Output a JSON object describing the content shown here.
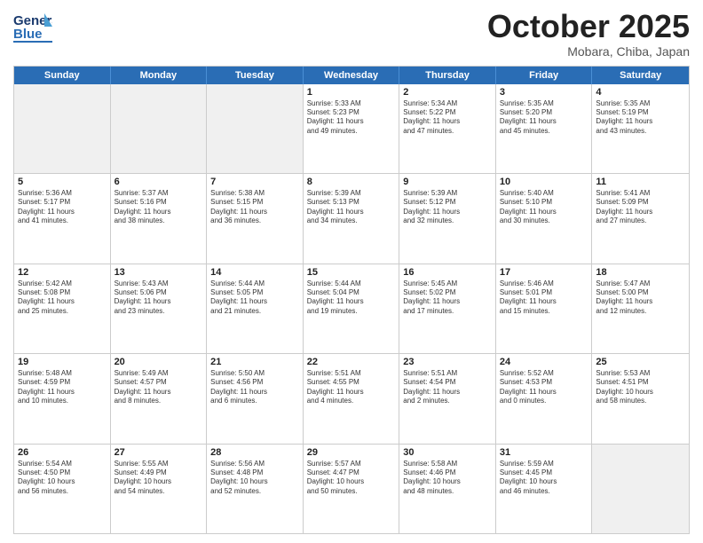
{
  "logo": {
    "line1": "General",
    "line2": "Blue"
  },
  "title": "October 2025",
  "subtitle": "Mobara, Chiba, Japan",
  "days": [
    "Sunday",
    "Monday",
    "Tuesday",
    "Wednesday",
    "Thursday",
    "Friday",
    "Saturday"
  ],
  "rows": [
    [
      {
        "day": "",
        "text": ""
      },
      {
        "day": "",
        "text": ""
      },
      {
        "day": "",
        "text": ""
      },
      {
        "day": "1",
        "text": "Sunrise: 5:33 AM\nSunset: 5:23 PM\nDaylight: 11 hours\nand 49 minutes."
      },
      {
        "day": "2",
        "text": "Sunrise: 5:34 AM\nSunset: 5:22 PM\nDaylight: 11 hours\nand 47 minutes."
      },
      {
        "day": "3",
        "text": "Sunrise: 5:35 AM\nSunset: 5:20 PM\nDaylight: 11 hours\nand 45 minutes."
      },
      {
        "day": "4",
        "text": "Sunrise: 5:35 AM\nSunset: 5:19 PM\nDaylight: 11 hours\nand 43 minutes."
      }
    ],
    [
      {
        "day": "5",
        "text": "Sunrise: 5:36 AM\nSunset: 5:17 PM\nDaylight: 11 hours\nand 41 minutes."
      },
      {
        "day": "6",
        "text": "Sunrise: 5:37 AM\nSunset: 5:16 PM\nDaylight: 11 hours\nand 38 minutes."
      },
      {
        "day": "7",
        "text": "Sunrise: 5:38 AM\nSunset: 5:15 PM\nDaylight: 11 hours\nand 36 minutes."
      },
      {
        "day": "8",
        "text": "Sunrise: 5:39 AM\nSunset: 5:13 PM\nDaylight: 11 hours\nand 34 minutes."
      },
      {
        "day": "9",
        "text": "Sunrise: 5:39 AM\nSunset: 5:12 PM\nDaylight: 11 hours\nand 32 minutes."
      },
      {
        "day": "10",
        "text": "Sunrise: 5:40 AM\nSunset: 5:10 PM\nDaylight: 11 hours\nand 30 minutes."
      },
      {
        "day": "11",
        "text": "Sunrise: 5:41 AM\nSunset: 5:09 PM\nDaylight: 11 hours\nand 27 minutes."
      }
    ],
    [
      {
        "day": "12",
        "text": "Sunrise: 5:42 AM\nSunset: 5:08 PM\nDaylight: 11 hours\nand 25 minutes."
      },
      {
        "day": "13",
        "text": "Sunrise: 5:43 AM\nSunset: 5:06 PM\nDaylight: 11 hours\nand 23 minutes."
      },
      {
        "day": "14",
        "text": "Sunrise: 5:44 AM\nSunset: 5:05 PM\nDaylight: 11 hours\nand 21 minutes."
      },
      {
        "day": "15",
        "text": "Sunrise: 5:44 AM\nSunset: 5:04 PM\nDaylight: 11 hours\nand 19 minutes."
      },
      {
        "day": "16",
        "text": "Sunrise: 5:45 AM\nSunset: 5:02 PM\nDaylight: 11 hours\nand 17 minutes."
      },
      {
        "day": "17",
        "text": "Sunrise: 5:46 AM\nSunset: 5:01 PM\nDaylight: 11 hours\nand 15 minutes."
      },
      {
        "day": "18",
        "text": "Sunrise: 5:47 AM\nSunset: 5:00 PM\nDaylight: 11 hours\nand 12 minutes."
      }
    ],
    [
      {
        "day": "19",
        "text": "Sunrise: 5:48 AM\nSunset: 4:59 PM\nDaylight: 11 hours\nand 10 minutes."
      },
      {
        "day": "20",
        "text": "Sunrise: 5:49 AM\nSunset: 4:57 PM\nDaylight: 11 hours\nand 8 minutes."
      },
      {
        "day": "21",
        "text": "Sunrise: 5:50 AM\nSunset: 4:56 PM\nDaylight: 11 hours\nand 6 minutes."
      },
      {
        "day": "22",
        "text": "Sunrise: 5:51 AM\nSunset: 4:55 PM\nDaylight: 11 hours\nand 4 minutes."
      },
      {
        "day": "23",
        "text": "Sunrise: 5:51 AM\nSunset: 4:54 PM\nDaylight: 11 hours\nand 2 minutes."
      },
      {
        "day": "24",
        "text": "Sunrise: 5:52 AM\nSunset: 4:53 PM\nDaylight: 11 hours\nand 0 minutes."
      },
      {
        "day": "25",
        "text": "Sunrise: 5:53 AM\nSunset: 4:51 PM\nDaylight: 10 hours\nand 58 minutes."
      }
    ],
    [
      {
        "day": "26",
        "text": "Sunrise: 5:54 AM\nSunset: 4:50 PM\nDaylight: 10 hours\nand 56 minutes."
      },
      {
        "day": "27",
        "text": "Sunrise: 5:55 AM\nSunset: 4:49 PM\nDaylight: 10 hours\nand 54 minutes."
      },
      {
        "day": "28",
        "text": "Sunrise: 5:56 AM\nSunset: 4:48 PM\nDaylight: 10 hours\nand 52 minutes."
      },
      {
        "day": "29",
        "text": "Sunrise: 5:57 AM\nSunset: 4:47 PM\nDaylight: 10 hours\nand 50 minutes."
      },
      {
        "day": "30",
        "text": "Sunrise: 5:58 AM\nSunset: 4:46 PM\nDaylight: 10 hours\nand 48 minutes."
      },
      {
        "day": "31",
        "text": "Sunrise: 5:59 AM\nSunset: 4:45 PM\nDaylight: 10 hours\nand 46 minutes."
      },
      {
        "day": "",
        "text": ""
      }
    ]
  ]
}
